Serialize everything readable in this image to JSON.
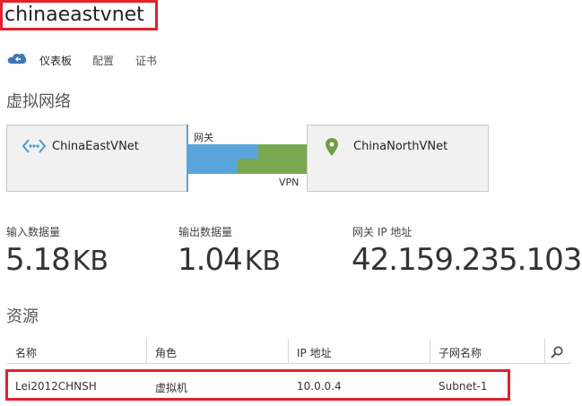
{
  "page": {
    "title": "chinaeastvnet",
    "highlight_color": "#e3202b"
  },
  "tabs": [
    {
      "label": "仪表板",
      "active": true
    },
    {
      "label": "配置",
      "active": false
    },
    {
      "label": "证书",
      "active": false
    }
  ],
  "logo_icon": "cloud-icon",
  "network": {
    "section_title": "虚拟网络",
    "local_site": {
      "name": "ChinaEastVNet",
      "icon": "network-dots-icon"
    },
    "remote_site": {
      "name": "ChinaNorthVNet",
      "icon": "location-pin-icon"
    },
    "gateway_label": "网关",
    "vpn_label": "VPN",
    "colors": {
      "local": "#5aa5dd",
      "remote": "#7aa850"
    }
  },
  "stats": {
    "data_in": {
      "label": "输入数据量",
      "value": "5.18",
      "unit": "KB"
    },
    "data_out": {
      "label": "输出数据量",
      "value": "1.04",
      "unit": "KB"
    },
    "gateway_ip": {
      "label": "网关 IP 地址",
      "value": "42.159.235.103"
    }
  },
  "resources": {
    "section_title": "资源",
    "columns": [
      "名称",
      "角色",
      "IP 地址",
      "子网名称"
    ],
    "rows": [
      {
        "name": "Lei2012CHNSH",
        "role": "虚拟机",
        "ip": "10.0.0.4",
        "subnet": "Subnet-1"
      }
    ],
    "search_icon": "search-icon"
  }
}
